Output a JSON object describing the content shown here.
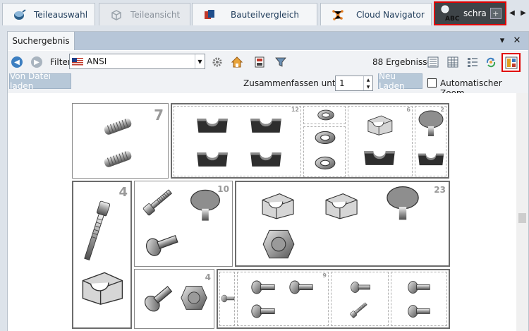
{
  "tabs": [
    {
      "label": "Teileauswahl",
      "icon": "catalog-icon",
      "active": false
    },
    {
      "label": "Teileansicht",
      "icon": "part-view-icon",
      "active": true
    },
    {
      "label": "Bauteilvergleich",
      "icon": "compare-icon",
      "active": false
    },
    {
      "label": "Cloud Navigator",
      "icon": "cloud-navigator-icon",
      "active": false
    }
  ],
  "search_tab": {
    "text": "schra",
    "icon_label": "ABC",
    "plus": "+"
  },
  "panel": {
    "title": "Suchergebnis",
    "pin": "▾",
    "close": "✕"
  },
  "toolbar": {
    "filter_label": "Filter:",
    "filter_value": "ANSI",
    "result_count": "88 Ergebnisse"
  },
  "toolbar2": {
    "load_from_file": "Von Datei laden",
    "merge_label": "Zusammenfassen unter:",
    "merge_value": "1",
    "reload": "Neu Laden",
    "auto_zoom": "Automatischer Zoom",
    "auto_zoom_checked": false
  },
  "groups": {
    "g1_count": "7",
    "g2_count": "12",
    "g2c_count": "6",
    "g2d_count": "2",
    "g3_count": "4",
    "g4_count": "10",
    "g5_count": "23",
    "g6_count": "4",
    "g7_count": "9"
  },
  "colors": {
    "highlight": "#e00000",
    "panel_header": "#b7c6d8",
    "button": "#b7c8d8"
  }
}
